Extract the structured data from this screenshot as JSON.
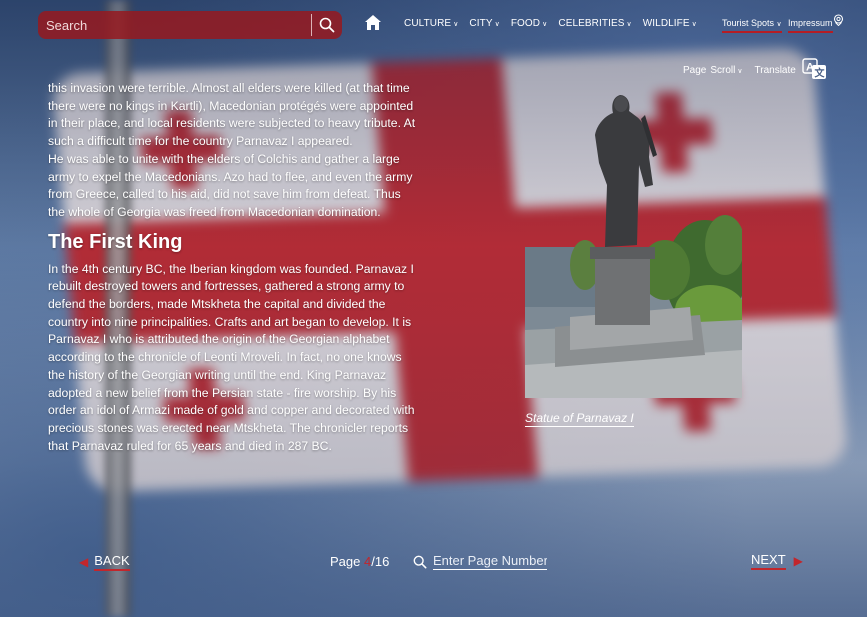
{
  "header": {
    "search_placeholder": "Search",
    "nav": [
      {
        "label": "CULTURE"
      },
      {
        "label": "CITY"
      },
      {
        "label": "FOOD"
      },
      {
        "label": "CELEBRITIES"
      },
      {
        "label": "WILDLIFE"
      }
    ],
    "tourist_spots": "Tourist Spots",
    "impressum": "Impressum"
  },
  "toolbar": {
    "page_label": "Page",
    "scroll_label": "Scroll",
    "translate_label": "Translate"
  },
  "article": {
    "paragraph_1": "this invasion were terrible. Almost all elders were killed (at that time there were no kings in Kartli), Macedonian protégés were appointed in their place, and local residents were subjected to heavy tribute. At such a difficult time for the country Parnavaz I appeared.",
    "paragraph_2": "He was able to unite with the elders of Colchis and gather a large army to expel the Macedonians. Azo had to flee, and even the army from Greece, called to his aid, did not save him from defeat. Thus the whole of Georgia was freed from Macedonian domination.",
    "heading": "The First King",
    "paragraph_3": "In the 4th century BC, the Iberian kingdom was founded. Parnavaz I rebuilt destroyed towers and fortresses, gathered a strong army to defend the borders, made Mtskheta the capital and divided the country into nine principalities. Crafts and art began to develop. It is Parnavaz I who is attributed the origin of the Georgian alphabet according to the chronicle of Leonti Mroveli. In fact, no one knows the history of the Georgian writing until the end. King Parnavaz adopted a new belief from the Persian state - fire worship. By his order an idol of Armazi made of gold and copper and decorated with precious stones was erected near Mtskheta. The chronicler reports that Parnavaz ruled for 65 years and died in 287 BC.",
    "image_caption": "Statue of Parnavaz I"
  },
  "pagination": {
    "back_label": "BACK",
    "next_label": "NEXT",
    "page_word": "Page",
    "current_page": "4",
    "total_pages": "/16",
    "goto_placeholder": "Enter Page Number"
  },
  "colors": {
    "accent_red": "#c2262c",
    "search_bg": "#96191e"
  }
}
